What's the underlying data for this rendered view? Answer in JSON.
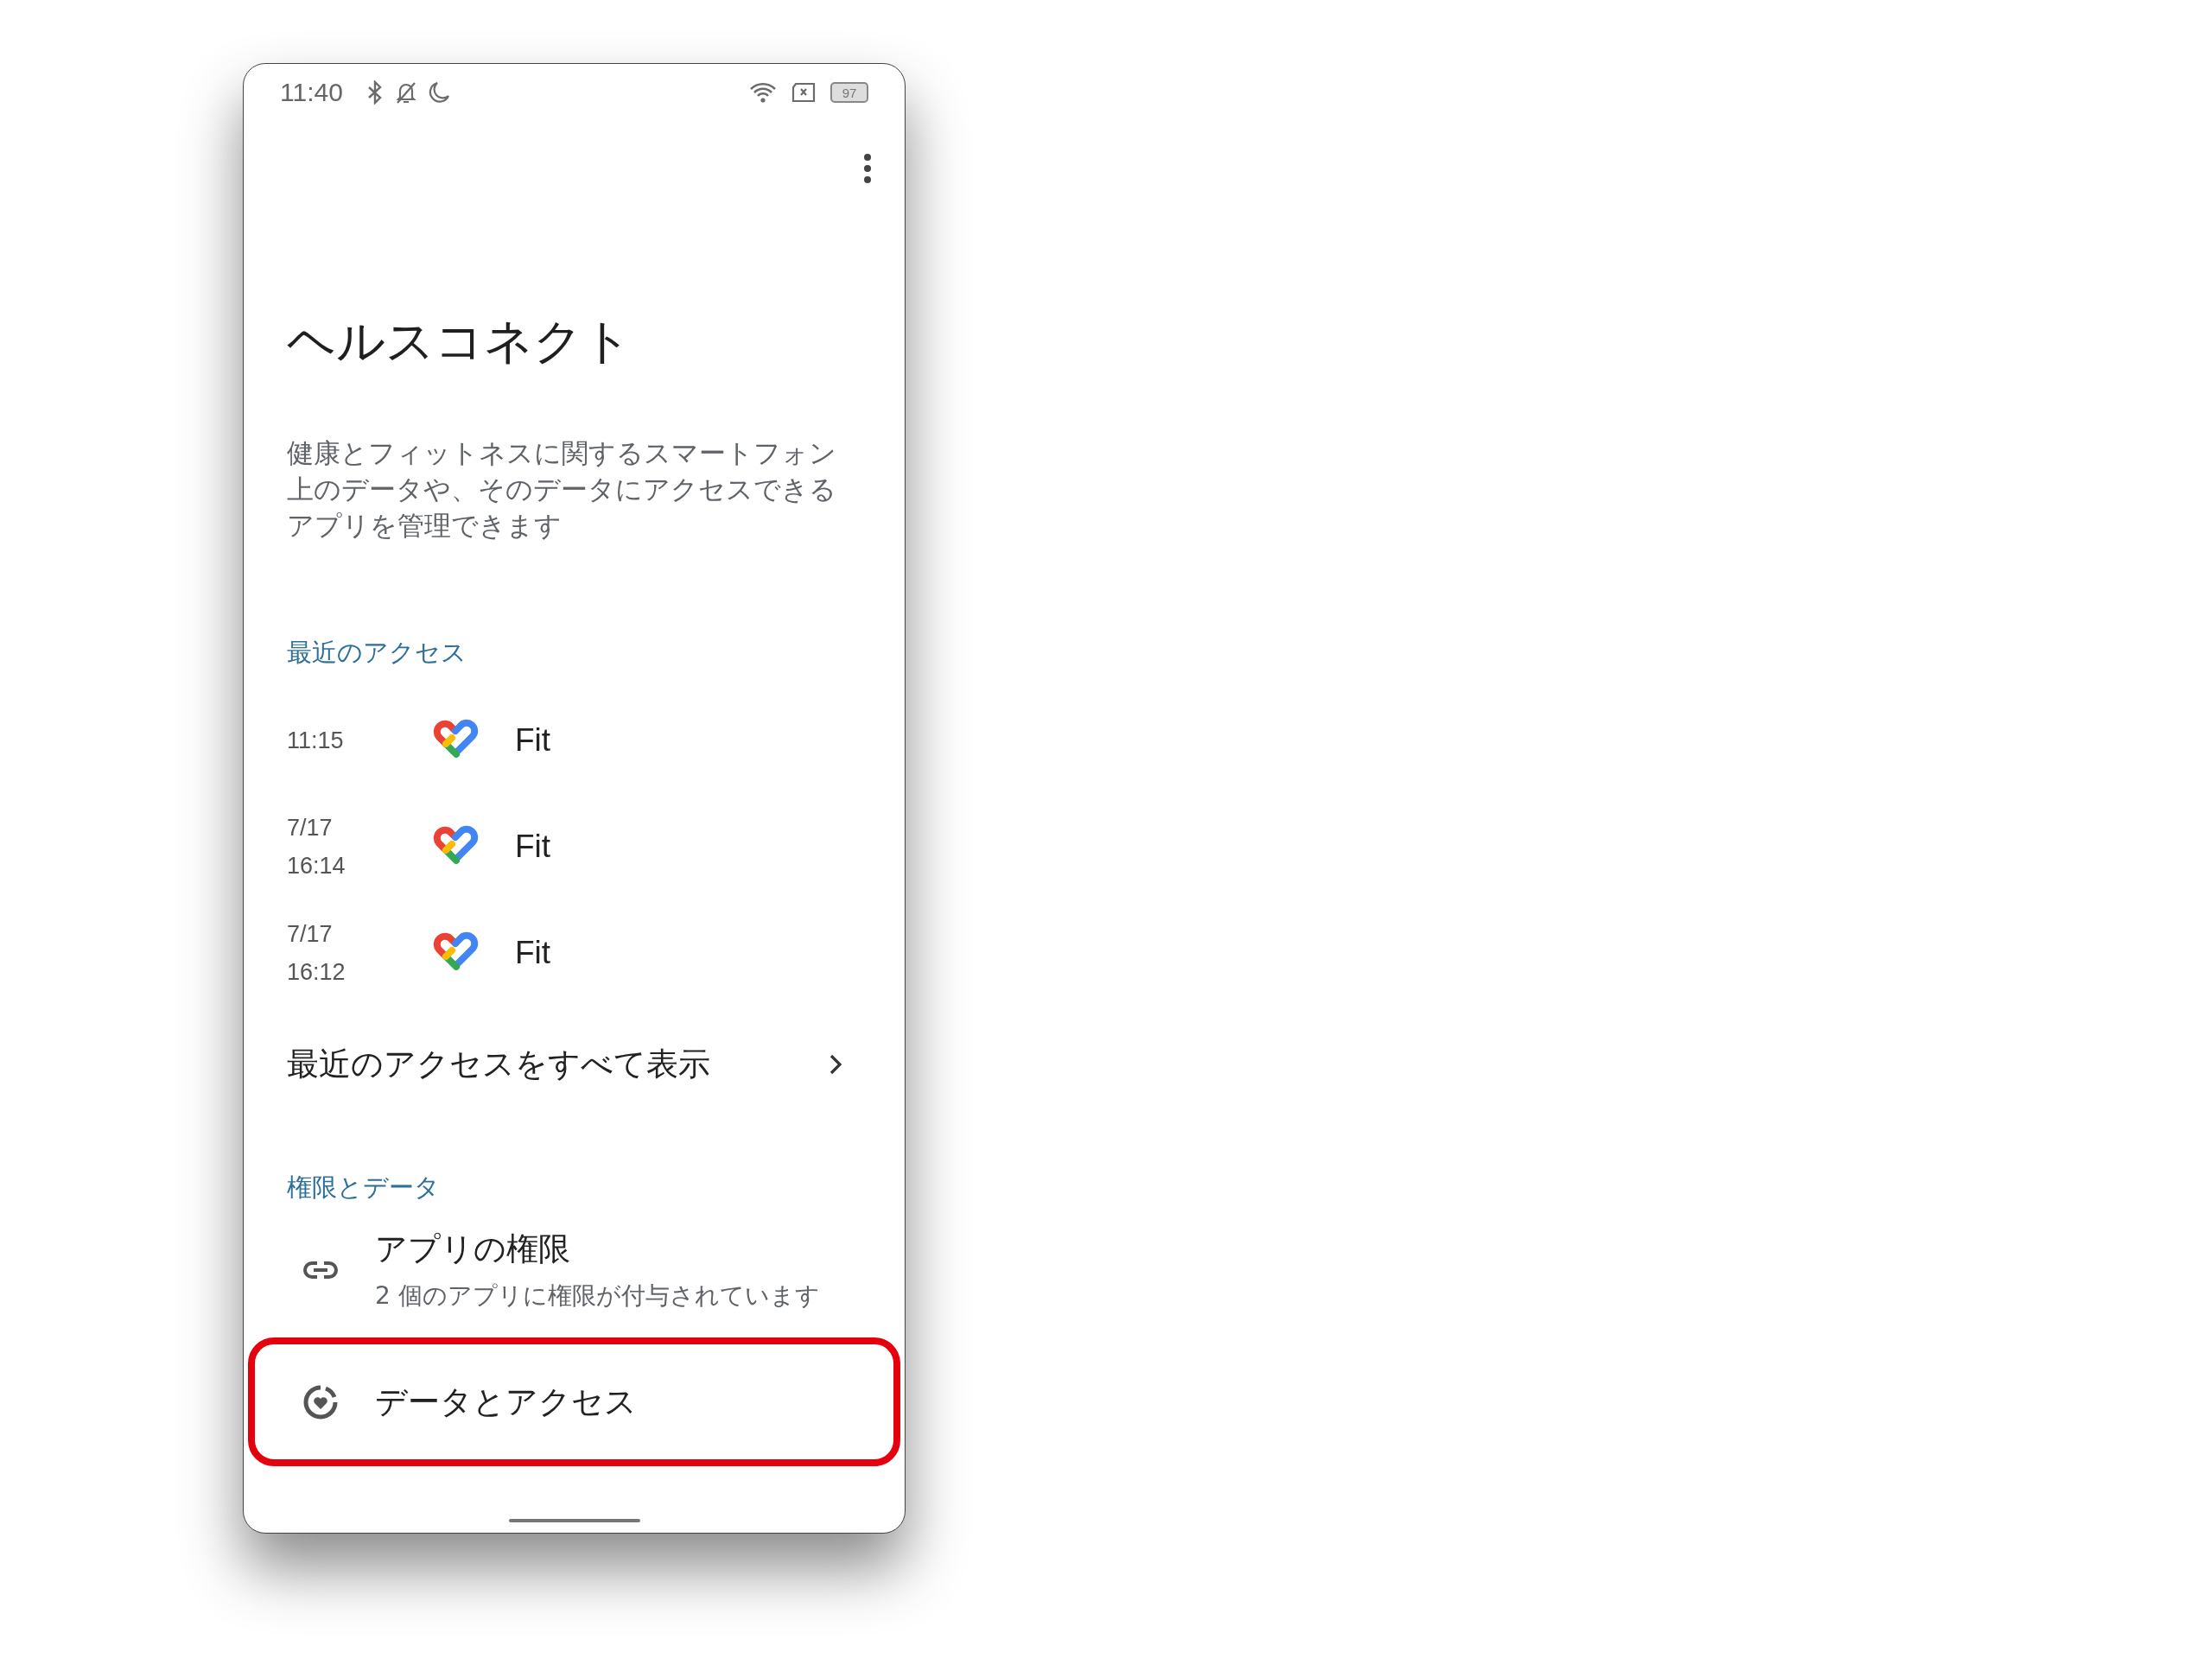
{
  "status_bar": {
    "time": "11:40",
    "battery": "97"
  },
  "title": "ヘルスコネクト",
  "description": "健康とフィットネスに関するスマートフォン上のデータや、そのデータにアクセスできるアプリを管理できます",
  "recent_access": {
    "header": "最近のアクセス",
    "entries": [
      {
        "when": [
          "11:15"
        ],
        "app": "Fit"
      },
      {
        "when": [
          "7/17",
          "16:14"
        ],
        "app": "Fit"
      },
      {
        "when": [
          "7/17",
          "16:12"
        ],
        "app": "Fit"
      }
    ],
    "show_all": "最近のアクセスをすべて表示"
  },
  "permissions": {
    "header": "権限とデータ",
    "items": [
      {
        "kind": "app-permissions",
        "title": "アプリの権限",
        "subtitle": "2 個のアプリに権限が付与されています",
        "highlighted": false
      },
      {
        "kind": "data-access",
        "title": "データとアクセス",
        "highlighted": true
      }
    ]
  }
}
